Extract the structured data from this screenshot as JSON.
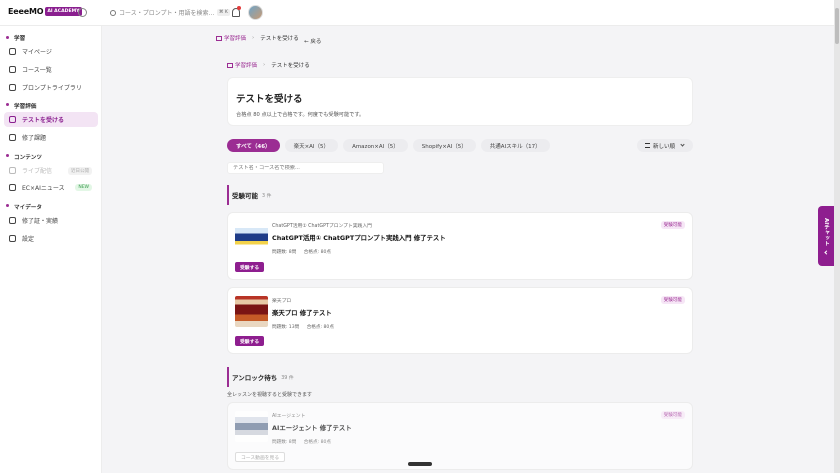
{
  "topbar": {
    "logo_text": "EeeeMO",
    "logo_badge": "AI ACADEMY",
    "search_placeholder": "コース・プロンプト・用語を検索...",
    "shortcut": "⌘ K"
  },
  "sidebar": {
    "sections": [
      {
        "title": "学習",
        "items": [
          {
            "label": "マイページ",
            "icon": "home-icon"
          },
          {
            "label": "コース一覧",
            "icon": "book-icon"
          },
          {
            "label": "プロンプトライブラリ",
            "icon": "sparkle-icon"
          }
        ]
      },
      {
        "title": "学習評価",
        "items": [
          {
            "label": "テストを受ける",
            "icon": "test-icon",
            "active": true
          },
          {
            "label": "修了課題",
            "icon": "badge-icon"
          }
        ]
      },
      {
        "title": "コンテンツ",
        "items": [
          {
            "label": "ライブ配信",
            "icon": "live-icon",
            "tag": "近日公開"
          },
          {
            "label": "EC×AIニュース",
            "icon": "news-icon",
            "tag": "NEW"
          }
        ]
      },
      {
        "title": "マイデータ",
        "items": [
          {
            "label": "修了証・実績",
            "icon": "certificate-icon"
          },
          {
            "label": "設定",
            "icon": "gear-icon"
          }
        ]
      }
    ]
  },
  "breadcrumb": {
    "parent": "学習評価",
    "current": "テストを受ける",
    "back": "← 戻る"
  },
  "header": {
    "title": "テストを受ける",
    "subtitle": "合格点 80 点以上で合格です。何度でも受験可能です。"
  },
  "tabs": [
    {
      "label": "すべて（46）",
      "active": true
    },
    {
      "label": "楽天×AI（5）"
    },
    {
      "label": "Amazon×AI（5）"
    },
    {
      "label": "Shopify×AI（5）"
    },
    {
      "label": "共通AIスキル（17）"
    }
  ],
  "sort": {
    "label": "新しい順"
  },
  "filter": {
    "placeholder": "テスト名・コース名で検索..."
  },
  "available": {
    "title": "受験可能",
    "count": "3 件",
    "cards": [
      {
        "category": "ChatGPT活用① ChatGPTプロンプト実践入門",
        "title": "ChatGPT活用① ChatGPTプロンプト実践入門 修了テスト",
        "questions": "問題数: 8問",
        "pass": "合格点: 80点",
        "badge": "受験可能",
        "button": "受験する"
      },
      {
        "category": "楽天プロ",
        "title": "楽天プロ 修了テスト",
        "questions": "問題数: 13問",
        "pass": "合格点: 80点",
        "badge": "受験可能",
        "button": "受験する"
      }
    ]
  },
  "locked": {
    "title": "アンロック待ち",
    "count": "39 件",
    "note": "全レッスンを視聴すると受験できます",
    "cards": [
      {
        "category": "AIエージェント",
        "title": "AIエージェント 修了テスト",
        "questions": "問題数: 8問",
        "pass": "合格点: 80点",
        "badge": "受験可能",
        "button": "コース動画を見る"
      }
    ]
  },
  "ai_chat": {
    "label": "AIチャット"
  },
  "colors": {
    "brand": "#9b2d93",
    "background": "#f4f4f6"
  }
}
